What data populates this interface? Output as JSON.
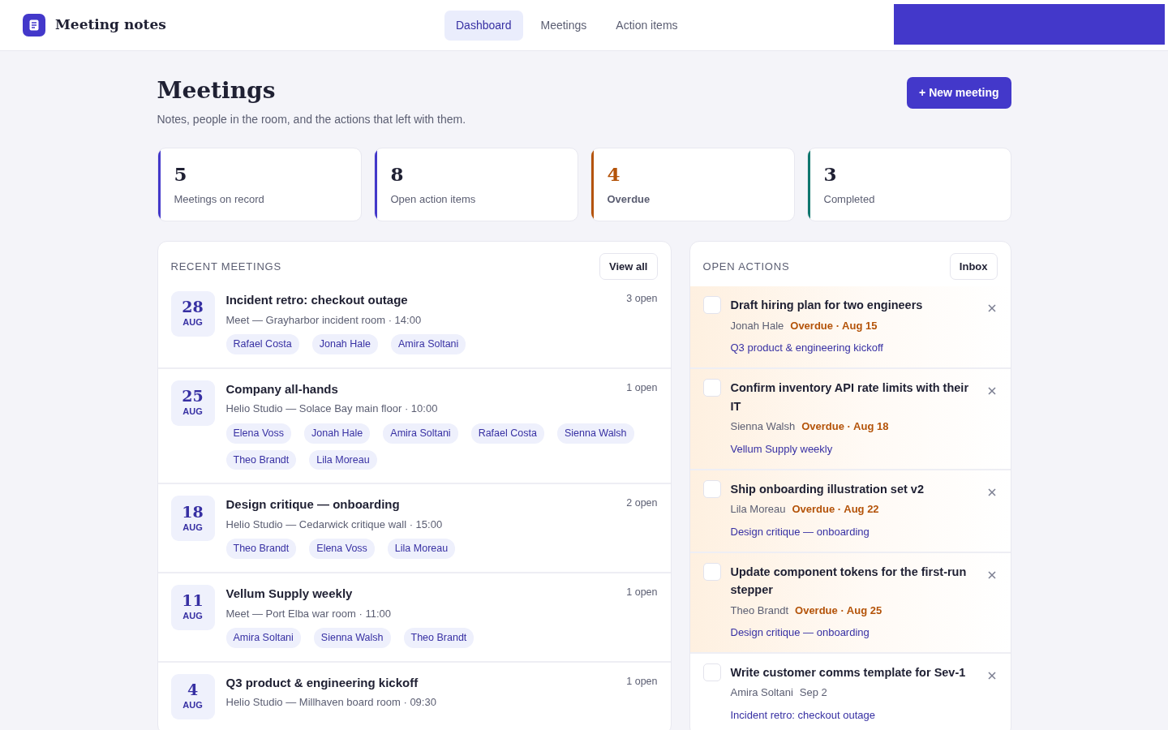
{
  "app": {
    "title": "Meeting notes"
  },
  "nav": [
    {
      "label": "Dashboard",
      "selected": true
    },
    {
      "label": "Meetings",
      "selected": false
    },
    {
      "label": "Action items",
      "selected": false
    }
  ],
  "page": {
    "title": "Meetings",
    "subtitle": "Notes, people in the room, and the actions that left with them.",
    "new_button": "+ New meeting"
  },
  "stats": [
    {
      "value": "5",
      "label": "Meetings on record",
      "color": "#4338ca",
      "kind": "default"
    },
    {
      "value": "8",
      "label": "Open action items",
      "color": "#4338ca",
      "kind": "default"
    },
    {
      "value": "4",
      "label": "Overdue",
      "color": "#b45309",
      "kind": "warning"
    },
    {
      "value": "3",
      "label": "Completed",
      "color": "#0f766e",
      "kind": "default"
    }
  ],
  "recent_meetings": {
    "heading": "RECENT MEETINGS",
    "button": "View all",
    "items": [
      {
        "day": "28",
        "month": "AUG",
        "title": "Incident retro: checkout outage",
        "meta": "Meet — Grayharbor incident room · 14:00",
        "open": "3 open",
        "people": [
          "Rafael Costa",
          "Jonah Hale",
          "Amira Soltani"
        ]
      },
      {
        "day": "25",
        "month": "AUG",
        "title": "Company all-hands",
        "meta": "Helio Studio — Solace Bay main floor · 10:00",
        "open": "1 open",
        "people": [
          "Elena Voss",
          "Jonah Hale",
          "Amira Soltani",
          "Rafael Costa",
          "Sienna Walsh",
          "Theo Brandt",
          "Lila Moreau"
        ]
      },
      {
        "day": "18",
        "month": "AUG",
        "title": "Design critique — onboarding",
        "meta": "Helio Studio — Cedarwick critique wall · 15:00",
        "open": "2 open",
        "people": [
          "Theo Brandt",
          "Elena Voss",
          "Lila Moreau"
        ]
      },
      {
        "day": "11",
        "month": "AUG",
        "title": "Vellum Supply weekly",
        "meta": "Meet — Port Elba war room · 11:00",
        "open": "1 open",
        "people": [
          "Amira Soltani",
          "Sienna Walsh",
          "Theo Brandt"
        ]
      },
      {
        "day": "4",
        "month": "AUG",
        "title": "Q3 product & engineering kickoff",
        "meta": "Helio Studio — Millhaven board room · 09:30",
        "open": "1 open"
      }
    ]
  },
  "open_actions": {
    "heading": "OPEN ACTIONS",
    "button": "Inbox",
    "items": [
      {
        "title": "Draft hiring plan for two engineers",
        "owner": "Jonah Hale",
        "due": "Overdue · Aug 15",
        "overdue": true,
        "checked": false,
        "meeting": "Q3 product & engineering kickoff"
      },
      {
        "title": "Confirm inventory API rate limits with their IT",
        "owner": "Sienna Walsh",
        "due": "Overdue · Aug 18",
        "overdue": true,
        "checked": false,
        "meeting": "Vellum Supply weekly"
      },
      {
        "title": "Ship onboarding illustration set v2",
        "owner": "Lila Moreau",
        "due": "Overdue · Aug 22",
        "overdue": true,
        "checked": false,
        "meeting": "Design critique — onboarding"
      },
      {
        "title": "Update component tokens for the first-run stepper",
        "owner": "Theo Brandt",
        "due": "Overdue · Aug 25",
        "overdue": true,
        "checked": false,
        "meeting": "Design critique — onboarding"
      },
      {
        "title": "Write customer comms template for Sev-1",
        "owner": "Amira Soltani",
        "due": "Sep 2",
        "overdue": false,
        "checked": false,
        "meeting": "Incident retro: checkout outage"
      }
    ]
  }
}
